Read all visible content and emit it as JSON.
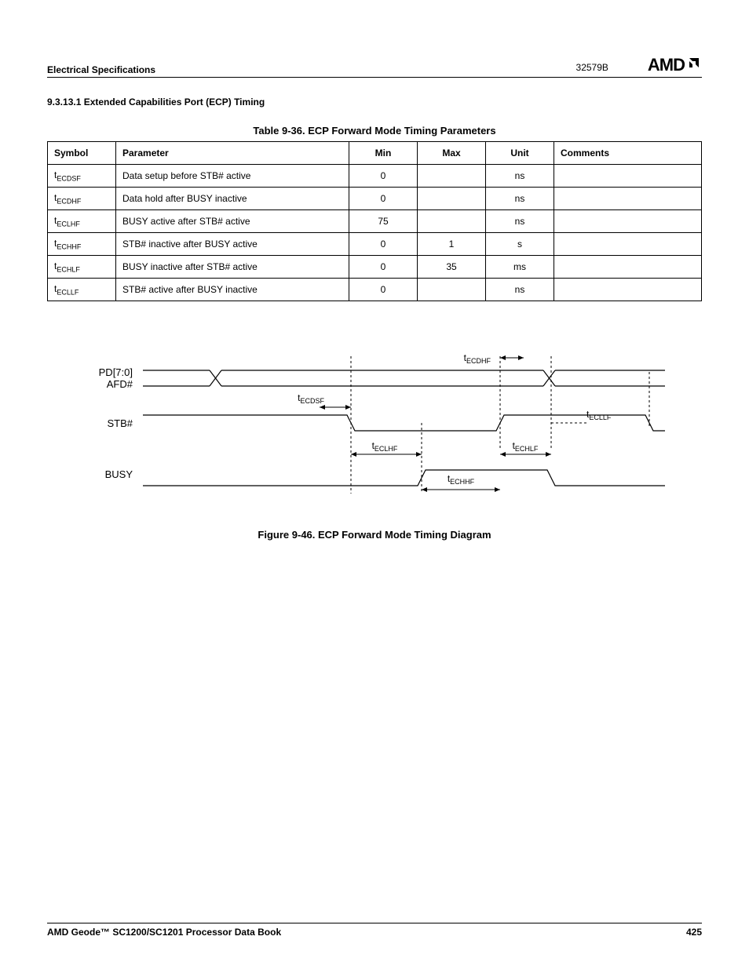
{
  "header": {
    "section": "Electrical Specifications",
    "docnum": "32579B",
    "logo_text": "AMD"
  },
  "section_heading": "9.3.13.1   Extended Capabilities Port (ECP) Timing",
  "table": {
    "caption": "Table 9-36.  ECP Forward Mode Timing Parameters",
    "headers": {
      "symbol": "Symbol",
      "parameter": "Parameter",
      "min": "Min",
      "max": "Max",
      "unit": "Unit",
      "comments": "Comments"
    },
    "rows": [
      {
        "sym_prefix": "t",
        "sym_sub": "ECDSF",
        "parameter": "Data setup before STB# active",
        "min": "0",
        "max": "",
        "unit": "ns",
        "comments": ""
      },
      {
        "sym_prefix": "t",
        "sym_sub": "ECDHF",
        "parameter": "Data hold after BUSY inactive",
        "min": "0",
        "max": "",
        "unit": "ns",
        "comments": ""
      },
      {
        "sym_prefix": "t",
        "sym_sub": "ECLHF",
        "parameter": "BUSY active after STB# active",
        "min": "75",
        "max": "",
        "unit": "ns",
        "comments": ""
      },
      {
        "sym_prefix": "t",
        "sym_sub": "ECHHF",
        "parameter": "STB# inactive after BUSY active",
        "min": "0",
        "max": "1",
        "unit": "s",
        "comments": ""
      },
      {
        "sym_prefix": "t",
        "sym_sub": "ECHLF",
        "parameter": "BUSY inactive after STB# active",
        "min": "0",
        "max": "35",
        "unit": "ms",
        "comments": ""
      },
      {
        "sym_prefix": "t",
        "sym_sub": "ECLLF",
        "parameter": "STB# active after BUSY inactive",
        "min": "0",
        "max": "",
        "unit": "ns",
        "comments": ""
      }
    ]
  },
  "diagram": {
    "signals": {
      "pd": "PD[7:0]",
      "afd": "AFD#",
      "stb": "STB#",
      "busy": "BUSY"
    },
    "labels": {
      "ecdhf": "ECDHF",
      "ecdsf": "ECDSF",
      "ecllf": "ECLLF",
      "eclhf": "ECLHF",
      "echlf": "ECHLF",
      "echhf": "ECHHF",
      "t": "t"
    }
  },
  "figure_caption": "Figure 9-46.  ECP Forward Mode Timing Diagram",
  "footer": {
    "left": "AMD Geode™ SC1200/SC1201 Processor Data Book",
    "right": "425"
  }
}
